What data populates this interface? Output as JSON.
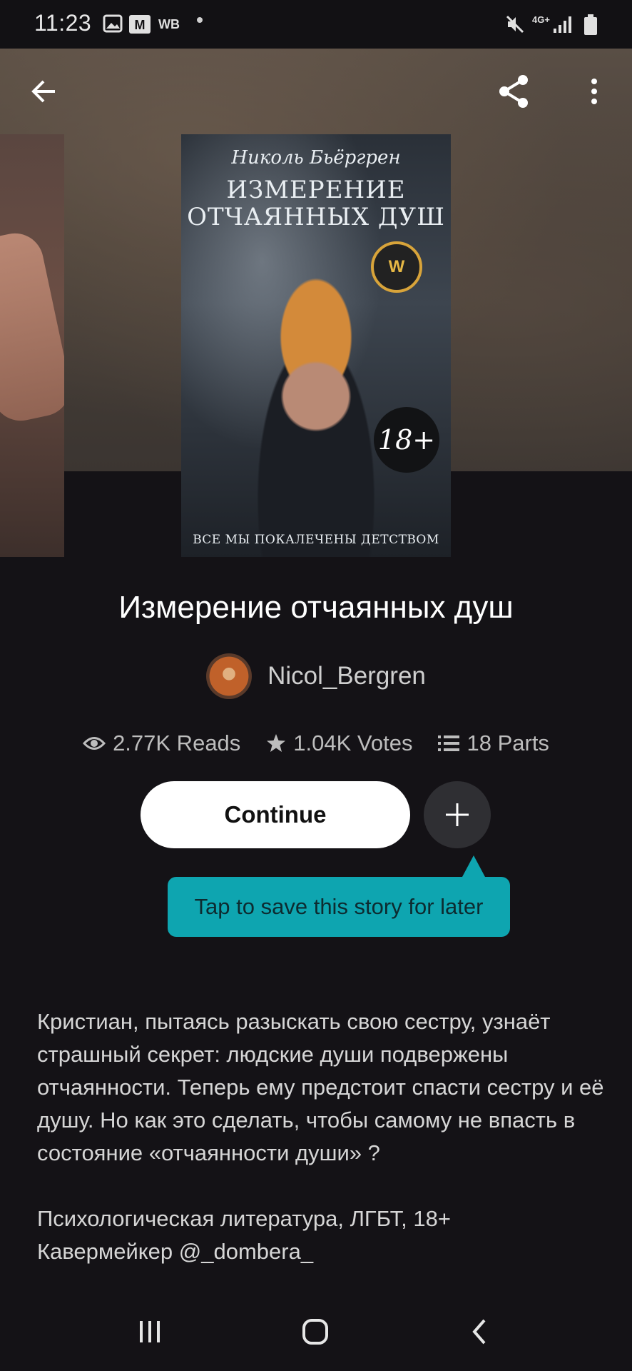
{
  "status_bar": {
    "time": "11:23",
    "carrier_label": "WB",
    "network_label": "4G+"
  },
  "header": {
    "back_icon": "arrow-left-icon",
    "share_icon": "share-icon",
    "menu_icon": "more-vertical-icon"
  },
  "cover": {
    "author": "Николь Бьёргрен",
    "title_line1": "ИЗМЕРЕНИЕ",
    "title_line2": "ОТЧАЯННЫХ ДУШ",
    "badge": "18+",
    "seal": "W",
    "tagline": "ВСЕ МЫ ПОКАЛЕЧЕНЫ ДЕТСТВОМ"
  },
  "book": {
    "title": "Измерение отчаянных душ",
    "author": "Nicol_Bergren",
    "reads": "2.77K Reads",
    "votes": "1.04K Votes",
    "parts": "18 Parts"
  },
  "actions": {
    "continue_label": "Continue",
    "add_icon": "plus-icon",
    "tooltip": "Tap to save this story for later"
  },
  "description": {
    "paragraph1": "Кристиан, пытаясь разыскать свою сестру, узнаёт страшный секрет: людские души подвержены отчаянности. Теперь ему предстоит спасти сестру и её душу. Но как это сделать, чтобы самому не впасть в состояние «отчаянности души» ?",
    "paragraph2_line1": "Психологическая литература, ЛГБТ, 18+",
    "paragraph2_line2": "Кавермейкер @_dombera_"
  },
  "colors": {
    "background": "#141216",
    "tooltip": "#0ea5b0",
    "button": "#ffffff"
  }
}
